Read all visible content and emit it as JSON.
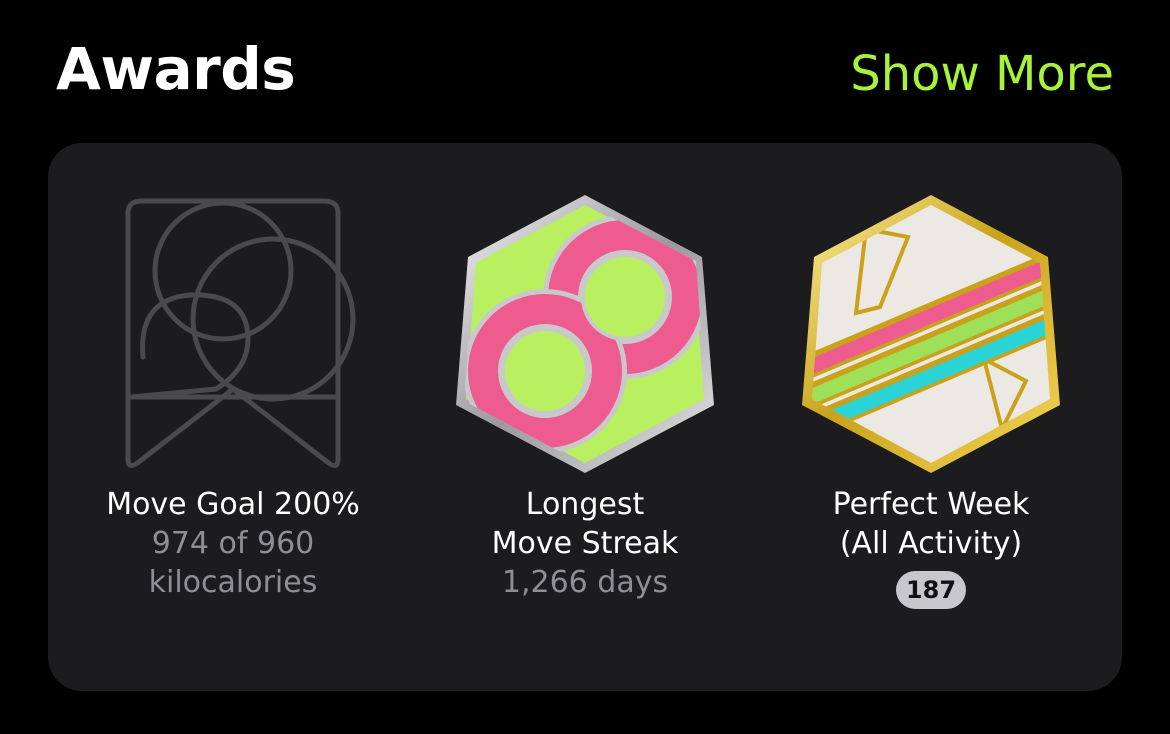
{
  "header": {
    "title": "Awards",
    "show_more": "Show More"
  },
  "colors": {
    "accent": "#a6f33a",
    "card_bg": "#1c1c1e",
    "secondary_text": "#8e8e93"
  },
  "awards": [
    {
      "icon": "move-goal-200-badge-icon",
      "title": "Move Goal 200%",
      "subtitle": "974 of 960\nkilocalories"
    },
    {
      "icon": "longest-move-streak-badge-icon",
      "title": "Longest\nMove Streak",
      "subtitle": "1,266 days"
    },
    {
      "icon": "perfect-week-all-activity-badge-icon",
      "title": "Perfect Week\n(All Activity)",
      "count": "187"
    }
  ]
}
